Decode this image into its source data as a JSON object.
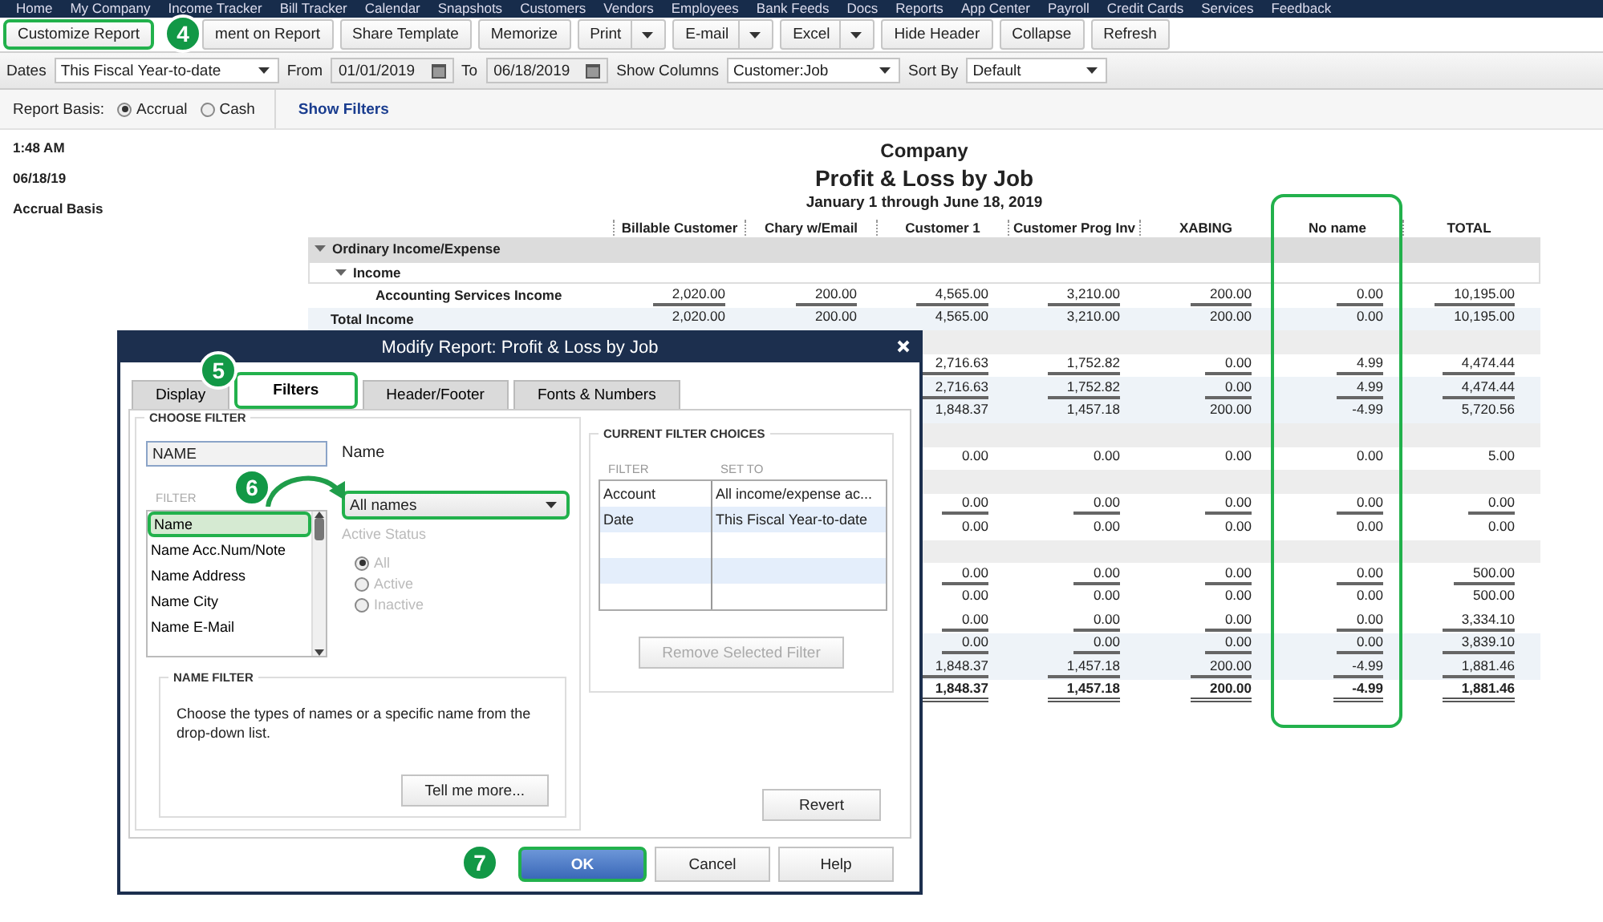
{
  "menu_bar": {
    "items": [
      "Home",
      "My Company",
      "Income Tracker",
      "Bill Tracker",
      "Calendar",
      "Snapshots",
      "Customers",
      "Vendors",
      "Employees",
      "Bank Feeds",
      "Docs",
      "Reports",
      "App Center",
      "Payroll",
      "Credit Cards",
      "Services",
      "Feedback"
    ]
  },
  "toolbar": {
    "buttons": [
      {
        "label": "Customize Report",
        "kind": "button",
        "highlighted": true,
        "callout": "4"
      },
      {
        "label": "ment on Report",
        "kind": "button",
        "highlighted": false
      },
      {
        "label": "Share Template",
        "kind": "button",
        "highlighted": false
      },
      {
        "label": "Memorize",
        "kind": "button",
        "highlighted": false
      },
      {
        "label": "Print",
        "kind": "split",
        "highlighted": false
      },
      {
        "label": "E-mail",
        "kind": "split",
        "highlighted": false
      },
      {
        "label": "Excel",
        "kind": "split",
        "highlighted": false
      },
      {
        "label": "Hide Header",
        "kind": "button",
        "highlighted": false
      },
      {
        "label": "Collapse",
        "kind": "button",
        "highlighted": false
      },
      {
        "label": "Refresh",
        "kind": "button",
        "highlighted": false
      }
    ]
  },
  "filter_bar": {
    "dates_label": "Dates",
    "dates": "This Fiscal Year-to-date",
    "from_label": "From",
    "from": "01/01/2019",
    "to_label": "To",
    "to": "06/18/2019",
    "columns_label": "Show Columns",
    "columns": "Customer:Job",
    "sort_label": "Sort By",
    "sort": "Default"
  },
  "basis_bar": {
    "label": "Report Basis:",
    "options": [
      {
        "label": "Accrual",
        "selected": true
      },
      {
        "label": "Cash",
        "selected": false
      }
    ],
    "link": "Show Filters"
  },
  "report_info": [
    "1:48 AM",
    "06/18/19",
    "Accrual Basis"
  ],
  "report": {
    "company": "Company",
    "title": "Profit & Loss by Job",
    "period": "January 1 through June 18, 2019",
    "columns": [
      {
        "label": "Billable Customer",
        "highlighted": false
      },
      {
        "label": "Chary w/Email",
        "highlighted": false
      },
      {
        "label": "Customer 1",
        "highlighted": false
      },
      {
        "label": "Customer Prog Inv",
        "highlighted": false
      },
      {
        "label": "XABING",
        "highlighted": false
      },
      {
        "label": "No name",
        "highlighted": true
      },
      {
        "label": "TOTAL",
        "highlighted": false
      }
    ],
    "rows": [
      {
        "kind": "section",
        "label": "Ordinary Income/Expense",
        "cells": []
      },
      {
        "kind": "group",
        "label": "Income",
        "cells": []
      },
      {
        "kind": "item",
        "label": "Accounting Services Income",
        "underlined": true,
        "cells": [
          "2,020.00",
          "200.00",
          "4,565.00",
          "3,210.00",
          "200.00",
          "0.00",
          "10,195.00"
        ]
      },
      {
        "kind": "total",
        "label": "Total Income",
        "underlined": false,
        "cells": [
          "2,020.00",
          "200.00",
          "4,565.00",
          "3,210.00",
          "200.00",
          "0.00",
          "10,195.00"
        ]
      },
      {
        "kind": "blank",
        "cells": []
      },
      {
        "kind": "line",
        "underlined": true,
        "cells": [
          null,
          null,
          "2,716.63",
          "1,752.82",
          "0.00",
          "4.99",
          "4,474.44"
        ]
      },
      {
        "kind": "total",
        "underlined": true,
        "cells": [
          null,
          null,
          "2,716.63",
          "1,752.82",
          "0.00",
          "4.99",
          "4,474.44"
        ]
      },
      {
        "kind": "total",
        "underlined": false,
        "cells": [
          null,
          null,
          "1,848.37",
          "1,457.18",
          "200.00",
          "-4.99",
          "5,720.56"
        ]
      },
      {
        "kind": "blank",
        "cells": []
      },
      {
        "kind": "line",
        "underlined": false,
        "cells": [
          null,
          null,
          "0.00",
          "0.00",
          "0.00",
          "0.00",
          "5.00"
        ]
      },
      {
        "kind": "blank",
        "cells": []
      },
      {
        "kind": "line",
        "underlined": true,
        "cells": [
          null,
          null,
          "0.00",
          "0.00",
          "0.00",
          "0.00",
          "0.00"
        ]
      },
      {
        "kind": "line",
        "underlined": false,
        "cells": [
          null,
          null,
          "0.00",
          "0.00",
          "0.00",
          "0.00",
          "0.00"
        ]
      },
      {
        "kind": "blank",
        "cells": []
      },
      {
        "kind": "line",
        "underlined": true,
        "cells": [
          null,
          null,
          "0.00",
          "0.00",
          "0.00",
          "0.00",
          "500.00"
        ]
      },
      {
        "kind": "line",
        "underlined": false,
        "cells": [
          null,
          null,
          "0.00",
          "0.00",
          "0.00",
          "0.00",
          "500.00"
        ]
      },
      {
        "kind": "line",
        "underlined": true,
        "cells": [
          null,
          null,
          "0.00",
          "0.00",
          "0.00",
          "0.00",
          "3,334.10"
        ]
      },
      {
        "kind": "total",
        "underlined": true,
        "cells": [
          null,
          null,
          "0.00",
          "0.00",
          "0.00",
          "0.00",
          "3,839.10"
        ]
      },
      {
        "kind": "total",
        "underlined": true,
        "cells": [
          null,
          null,
          "1,848.37",
          "1,457.18",
          "200.00",
          "-4.99",
          "1,881.46"
        ]
      },
      {
        "kind": "grand_total",
        "underlined": true,
        "cells": [
          null,
          null,
          "1,848.37",
          "1,457.18",
          "200.00",
          "-4.99",
          "1,881.46"
        ]
      }
    ]
  },
  "dialog": {
    "title": "Modify Report: Profit & Loss by Job",
    "tabs": [
      {
        "label": "Display",
        "selected": false,
        "highlighted": false
      },
      {
        "label": "Filters",
        "selected": true,
        "highlighted": true,
        "callout": "5"
      },
      {
        "label": "Header/Footer",
        "selected": false,
        "highlighted": false
      },
      {
        "label": "Fonts & Numbers",
        "selected": false,
        "highlighted": false
      }
    ],
    "choose_filter": {
      "heading": "CHOOSE FILTER",
      "search": "NAME",
      "list_label": "FILTER",
      "items": [
        {
          "label": "Name",
          "selected": true,
          "highlighted": true,
          "callout": "6"
        },
        {
          "label": "Name Acc.Num/Note",
          "selected": false,
          "highlighted": false
        },
        {
          "label": "Name Address",
          "selected": false,
          "highlighted": false
        },
        {
          "label": "Name City",
          "selected": false,
          "highlighted": false
        },
        {
          "label": "Name E-Mail",
          "selected": false,
          "highlighted": false
        }
      ],
      "field_label": "Name",
      "dropdown": {
        "value": "All names",
        "highlighted": true
      },
      "status_label": "Active Status",
      "status_disabled": true,
      "status_options": [
        {
          "label": "All",
          "selected": true
        },
        {
          "label": "Active",
          "selected": false
        },
        {
          "label": "Inactive",
          "selected": false
        }
      ]
    },
    "name_filter": {
      "heading": "NAME FILTER",
      "text": "Choose the types of names or a specific name from the drop-down list.",
      "button": "Tell me more..."
    },
    "current": {
      "heading": "CURRENT FILTER CHOICES",
      "columns": [
        "FILTER",
        "SET TO"
      ],
      "rows": [
        [
          "Account",
          "All income/expense ac..."
        ],
        [
          "Date",
          "This Fiscal Year-to-date"
        ]
      ],
      "remove_button": "Remove Selected Filter",
      "remove_disabled": true
    },
    "revert": "Revert",
    "buttons": [
      {
        "label": "OK",
        "kind": "primary",
        "highlighted": true,
        "callout": "7"
      },
      {
        "label": "Cancel",
        "kind": "normal",
        "highlighted": false
      },
      {
        "label": "Help",
        "kind": "normal",
        "highlighted": false
      }
    ]
  }
}
